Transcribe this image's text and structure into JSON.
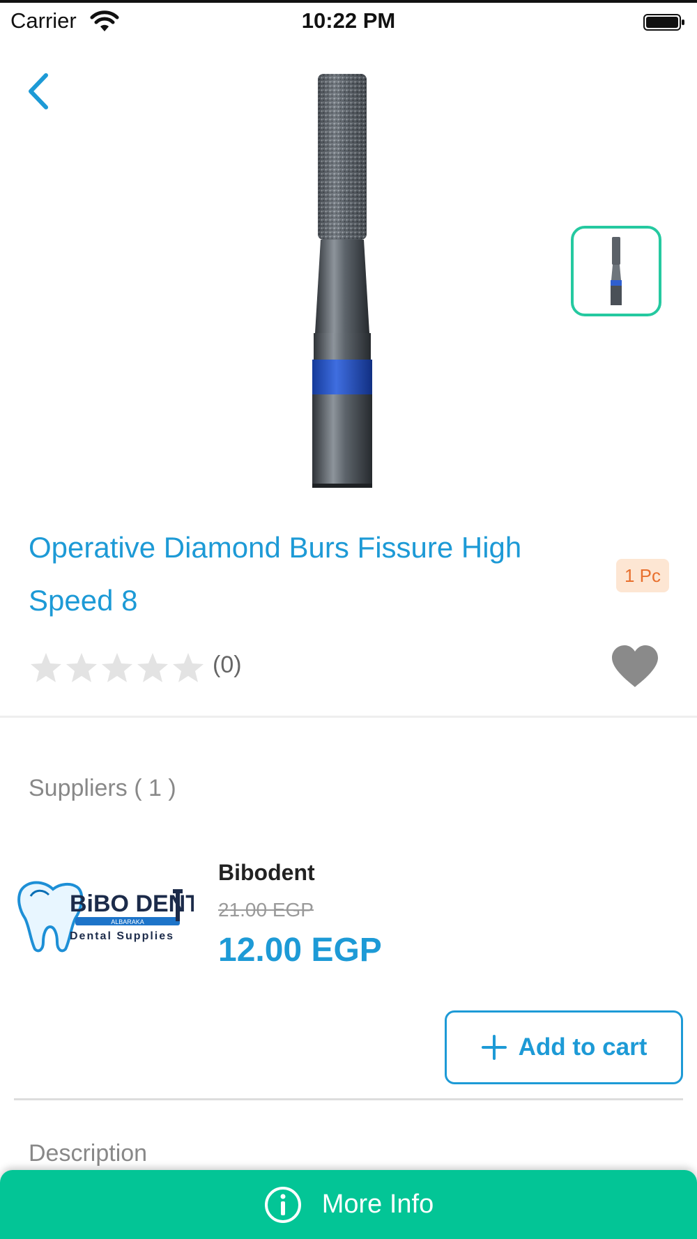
{
  "status_bar": {
    "carrier": "Carrier",
    "time": "10:22 PM"
  },
  "product": {
    "title": "Operative Diamond Burs Fissure High Speed 8",
    "unit_badge": "1 Pc",
    "rating": 0,
    "rating_max": 5,
    "rating_count": "(0)",
    "image_count": 1
  },
  "suppliers_section": {
    "label": "Suppliers ( 1 )",
    "suppliers": [
      {
        "name": "Bibodent",
        "old_price": "21.00 EGP",
        "price": "12.00 EGP",
        "logo": {
          "brand_text": "BiBO DENT",
          "band_text": "ALBARAKA",
          "tagline": "Dental Supplies"
        },
        "add_to_cart_label": "Add to cart"
      }
    ]
  },
  "description_section": {
    "label": "Description"
  },
  "bottom_bar": {
    "more_info_label": "More Info"
  },
  "icons": {
    "back": "chevron-left-icon",
    "favorite": "heart-icon",
    "add": "plus-icon",
    "info": "info-circle-icon",
    "wifi": "wifi-icon",
    "battery": "battery-icon",
    "star": "star-icon"
  },
  "colors": {
    "primary_blue": "#1d9ad6",
    "accent_green": "#03c596",
    "thumb_border": "#25c9a0",
    "badge_bg": "#fde6d3",
    "badge_text": "#e8702e",
    "star_empty": "#e3e3e3",
    "heart": "#8a8a8a"
  }
}
